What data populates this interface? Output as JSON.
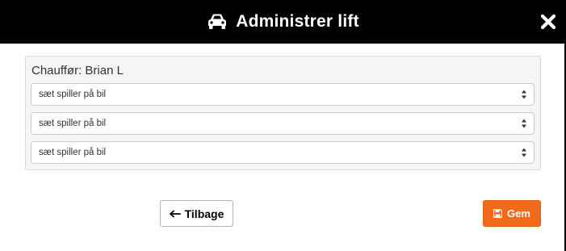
{
  "header": {
    "title": "Administrer lift",
    "title_icon": "car-icon",
    "close_icon": "close-icon"
  },
  "panel": {
    "driver_label": "Chauffør: Brian L",
    "selects": [
      {
        "value": "sæt spiller på bil"
      },
      {
        "value": "sæt spiller på bil"
      },
      {
        "value": "sæt spiller på bil"
      }
    ]
  },
  "footer": {
    "back_label": "Tilbage",
    "back_icon": "arrow-left-icon",
    "save_label": "Gem",
    "save_icon": "floppy-disk-icon"
  },
  "colors": {
    "header_bg": "#000000",
    "accent": "#f26b1d",
    "panel_bg": "#f5f5f5"
  }
}
